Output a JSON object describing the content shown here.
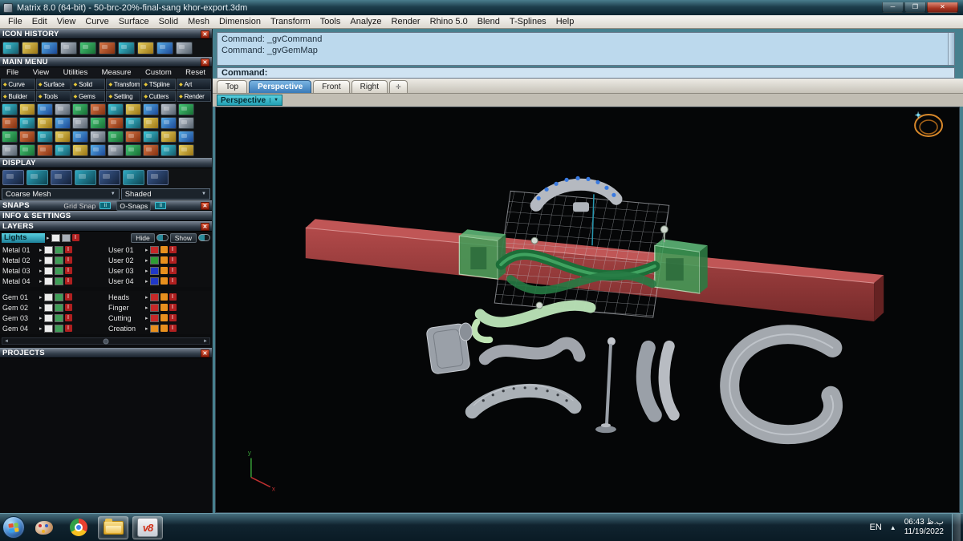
{
  "icons": {
    "close": "✕",
    "minimize": "─",
    "maximize": "❐",
    "dropdown": "▼",
    "arrow_left": "◄",
    "arrow_right": "►",
    "arrow_small": "▸",
    "plus": "✛",
    "bullet": "◆",
    "chevron_up": "▲",
    "toggle_bars": "II",
    "info": "I"
  },
  "window": {
    "title": "Matrix 8.0 (64-bit) - 50-brc-20%-final-sang khor-export.3dm"
  },
  "menubar": {
    "items": [
      "File",
      "Edit",
      "View",
      "Curve",
      "Surface",
      "Solid",
      "Mesh",
      "Dimension",
      "Transform",
      "Tools",
      "Analyze",
      "Render",
      "Rhino 5.0",
      "Blend",
      "T-Splines",
      "Help"
    ]
  },
  "sidebar": {
    "icon_history_title": "ICON HISTORY",
    "main_menu_title": "MAIN MENU",
    "main_menu_top": [
      "File",
      "View",
      "Utilities",
      "Measure",
      "Custom",
      "Reset"
    ],
    "main_menu_row1": [
      "Curve",
      "Surface",
      "Solid",
      "Transform",
      "TSpline",
      "Art"
    ],
    "main_menu_row2": [
      "Builder",
      "Tools",
      "Gems",
      "Setting",
      "Cutters",
      "Render"
    ],
    "display_title": "DISPLAY",
    "mesh_mode": "Coarse Mesh",
    "shade_mode": "Shaded",
    "snaps_title": "SNAPS",
    "grid_snap": "Grid Snap",
    "o_snaps": "O-Snaps",
    "info_title": "INFO & SETTINGS",
    "layers_title": "LAYERS",
    "selected_layer": "Lights",
    "hide_label": "Hide",
    "show_label": "Show",
    "layer_rows": [
      {
        "left": "Metal 01",
        "right": "User 01",
        "right_color": "#c62828"
      },
      {
        "left": "Metal 02",
        "right": "User 02",
        "right_color": "#2e9e34"
      },
      {
        "left": "Metal 03",
        "right": "User 03",
        "right_color": "#2038c8"
      },
      {
        "left": "Metal 04",
        "right": "User 04",
        "right_color": "#2038c8"
      },
      {
        "left": "Gem 01",
        "right": "Heads",
        "right_color": "#c62828"
      },
      {
        "left": "Gem 02",
        "right": "Finger",
        "right_color": "#c62828"
      },
      {
        "left": "Gem 03",
        "right": "Cutting",
        "right_color": "#c62828"
      },
      {
        "left": "Gem 04",
        "right": "Creation",
        "right_color": "#e8901e"
      }
    ],
    "projects_title": "PROJECTS"
  },
  "command": {
    "history_line1": "Command: _gvCommand",
    "history_line2": "Command: _gvGemMap",
    "prompt": "Command:"
  },
  "viewport": {
    "tabs": [
      "Top",
      "Perspective",
      "Front",
      "Right"
    ],
    "active_tab": "Perspective",
    "view_label": "Perspective",
    "axis_x": "x",
    "axis_y": "y"
  },
  "taskbar": {
    "language": "EN",
    "time": "ب.ظ 06:43",
    "date": "11/19/2022",
    "v8_logo": "v8"
  },
  "colors": {
    "band_red": "#a04040",
    "clamp_green": "#3f9e58",
    "accent_teal": "#38bccc"
  }
}
